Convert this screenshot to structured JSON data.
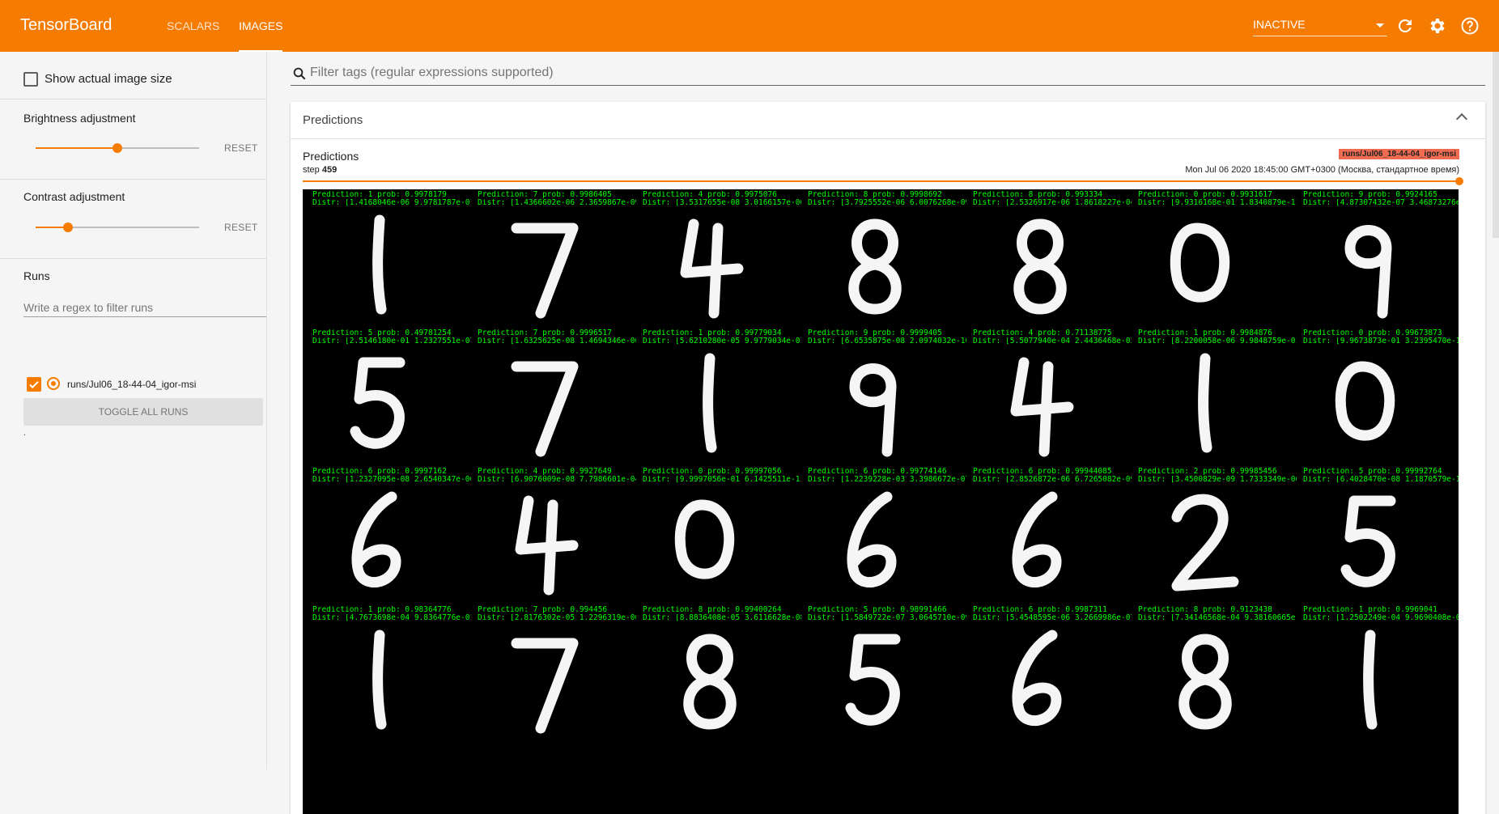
{
  "header": {
    "brand": "TensorBoard",
    "tabs": [
      {
        "label": "SCALARS"
      },
      {
        "label": "IMAGES"
      }
    ],
    "status_value": "INACTIVE",
    "icons": [
      "refresh-icon",
      "gear-icon",
      "help-icon"
    ],
    "accent": "#f57c00"
  },
  "sidebar": {
    "show_actual_size_label": "Show actual image size",
    "brightness_label": "Brightness adjustment",
    "brightness_value": 0.5,
    "contrast_label": "Contrast adjustment",
    "contrast_value": 0.2,
    "reset_label": "RESET",
    "runs_label": "Runs",
    "runs_filter_placeholder": "Write a regex to filter runs",
    "run_name": "runs/Jul06_18-44-04_igor-msi",
    "toggle_label": "TOGGLE ALL RUNS",
    "dot": "."
  },
  "main": {
    "filter_placeholder": "Filter tags (regular expressions supported)",
    "card_title": "Predictions",
    "panel_title": "Predictions",
    "step_prefix": "step",
    "step_value": "459",
    "run_badge": "runs/Jul06_18-44-04_igor-msi",
    "timestamp": "Mon Jul 06 2020 18:45:00 GMT+0300 (Москва, стандартное время)"
  },
  "images": [
    {
      "p": "Prediction: 1 prob: 0.9978179",
      "d": "Distr: [1.4168046e-06 9.9781787e-01",
      "digit": "1"
    },
    {
      "p": "Prediction: 7 prob: 0.9986405",
      "d": "Distr: [1.4366602e-06 2.3659867e-09",
      "digit": "7"
    },
    {
      "p": "Prediction: 4 prob: 0.9975076",
      "d": "Distr: [3.5317655e-08 3.0166157e-06",
      "digit": "4"
    },
    {
      "p": "Prediction: 8 prob: 0.9998692",
      "d": "Distr: [3.7925552e-06 6.0076268e-09",
      "digit": "8"
    },
    {
      "p": "Prediction: 8 prob: 0.993334",
      "d": "Distr: [2.5326917e-06 1.8618227e-04",
      "digit": "8"
    },
    {
      "p": "Prediction: 0 prob: 0.9931617",
      "d": "Distr: [9.9316168e-01 1.8340879e-11",
      "digit": "0"
    },
    {
      "p": "Prediction: 9 prob: 0.9924165",
      "d": "Distr: [4.87307432e-07 3.46873276e-",
      "digit": "9"
    },
    {
      "p": "Prediction: 5 prob: 0.49781254",
      "d": "Distr: [2.5146180e-01 1.2327551e-07",
      "digit": "5"
    },
    {
      "p": "Prediction: 7 prob: 0.9996517",
      "d": "Distr: [1.6325625e-08 1.4694346e-06",
      "digit": "7"
    },
    {
      "p": "Prediction: 1 prob: 0.99779034",
      "d": "Distr: [5.6210280e-05 9.9779034e-01",
      "digit": "1"
    },
    {
      "p": "Prediction: 9 prob: 0.9999405",
      "d": "Distr: [6.6535875e-08 2.0974032e-10",
      "digit": "9"
    },
    {
      "p": "Prediction: 4 prob: 0.71138775",
      "d": "Distr: [5.5077940e-04 2.4436468e-03",
      "digit": "4"
    },
    {
      "p": "Prediction: 1 prob: 0.9984876",
      "d": "Distr: [8.2200058e-06 9.9848759e-01",
      "digit": "1"
    },
    {
      "p": "Prediction: 0 prob: 0.99673873",
      "d": "Distr: [9.9673873e-01 3.2395470e-10",
      "digit": "0"
    },
    {
      "p": "Prediction: 6 prob: 0.9997162",
      "d": "Distr: [1.2327095e-08 2.6540347e-06",
      "digit": "6"
    },
    {
      "p": "Prediction: 4 prob: 0.9927649",
      "d": "Distr: [6.9076009e-08 7.7986601e-04",
      "digit": "4"
    },
    {
      "p": "Prediction: 0 prob: 0.99997056",
      "d": "Distr: [9.9997056e-01 6.1425511e-11",
      "digit": "0"
    },
    {
      "p": "Prediction: 6 prob: 0.99774146",
      "d": "Distr: [1.2239228e-03 3.3986672e-07",
      "digit": "6"
    },
    {
      "p": "Prediction: 6 prob: 0.99944085",
      "d": "Distr: [2.8526872e-06 6.7265082e-09",
      "digit": "6"
    },
    {
      "p": "Prediction: 2 prob: 0.99985456",
      "d": "Distr: [3.4500829e-09 1.7333349e-06",
      "digit": "2"
    },
    {
      "p": "Prediction: 5 prob: 0.99992764",
      "d": "Distr: [6.4028470e-08 1.1870579e-11",
      "digit": "5"
    },
    {
      "p": "Prediction: 1 prob: 0.98364776",
      "d": "Distr: [4.7673698e-04 9.8364776e-01",
      "digit": "1"
    },
    {
      "p": "Prediction: 7 prob: 0.994456",
      "d": "Distr: [2.8176302e-05 1.2296319e-06",
      "digit": "7"
    },
    {
      "p": "Prediction: 8 prob: 0.99400264",
      "d": "Distr: [8.8836408e-05 3.6116628e-08",
      "digit": "8"
    },
    {
      "p": "Prediction: 5 prob: 0.98991466",
      "d": "Distr: [1.5849722e-07 3.0645710e-09",
      "digit": "5"
    },
    {
      "p": "Prediction: 6 prob: 0.9987311",
      "d": "Distr: [5.4548595e-06 3.2669986e-07",
      "digit": "6"
    },
    {
      "p": "Prediction: 8 prob: 0.9123438",
      "d": "Distr: [7.34146568e-04 9.38160665e-",
      "digit": "8"
    },
    {
      "p": "Prediction: 1 prob: 0.9969041",
      "d": "Distr: [1.2502249e-04 9.9690408e-01",
      "digit": "1"
    }
  ]
}
